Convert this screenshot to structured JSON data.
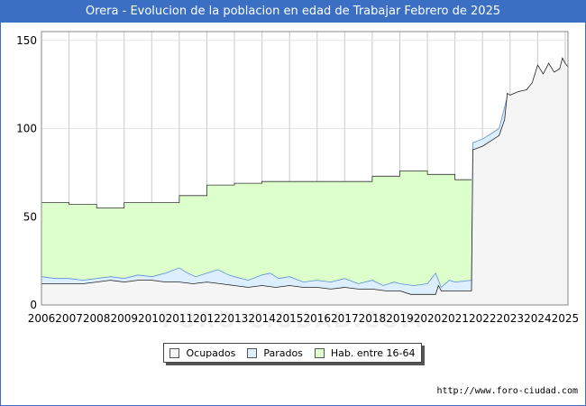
{
  "header": {
    "title": "Orera - Evolucion de la poblacion en edad de Trabajar Febrero de 2025"
  },
  "watermark": "FORO-CIUDAD.COM",
  "footer": {
    "url": "http://www.foro-ciudad.com"
  },
  "colors": {
    "header_bg": "#3a6fc4",
    "ocupados_fill": "#f5f5f5",
    "ocupados_line": "#222222",
    "parados_fill": "#ddeeff",
    "parados_line": "#5b8fd6",
    "hab_fill": "#ddffcc",
    "hab_line": "#333333",
    "grid": "#c8c8c8"
  },
  "chart_data": {
    "type": "area",
    "title": "Orera - Evolucion de la poblacion en edad de Trabajar Febrero de 2025",
    "xlim": [
      2006,
      2025.1
    ],
    "ylim": [
      0,
      155
    ],
    "x_ticks": [
      2006,
      2007,
      2008,
      2009,
      2010,
      2011,
      2012,
      2013,
      2014,
      2015,
      2016,
      2017,
      2018,
      2019,
      2020,
      2021,
      2022,
      2023,
      2024,
      2025
    ],
    "y_ticks": [
      0,
      50,
      100,
      150
    ],
    "grid": "vertical-and-horizontal",
    "legend": {
      "position": "bottom-center",
      "entries": [
        "Ocupados",
        "Parados",
        "Hab. entre 16-64"
      ]
    },
    "series": [
      {
        "name": "Hab. entre 16-64",
        "style": "step",
        "points": [
          [
            2006,
            58
          ],
          [
            2007,
            57
          ],
          [
            2008,
            55
          ],
          [
            2009,
            58
          ],
          [
            2011,
            62
          ],
          [
            2012,
            68
          ],
          [
            2013,
            69
          ],
          [
            2014,
            70
          ],
          [
            2018,
            73
          ],
          [
            2019,
            76
          ],
          [
            2020,
            74
          ],
          [
            2021,
            71
          ],
          [
            2021.6,
            71
          ]
        ]
      },
      {
        "name": "Parados",
        "style": "line",
        "points": [
          [
            2006,
            16
          ],
          [
            2006.5,
            15
          ],
          [
            2007,
            15
          ],
          [
            2007.5,
            14
          ],
          [
            2008,
            15
          ],
          [
            2008.5,
            16
          ],
          [
            2009,
            15
          ],
          [
            2009.5,
            17
          ],
          [
            2010,
            16
          ],
          [
            2010.5,
            18
          ],
          [
            2011,
            21
          ],
          [
            2011.3,
            18
          ],
          [
            2011.6,
            16
          ],
          [
            2012,
            18
          ],
          [
            2012.4,
            20
          ],
          [
            2012.8,
            17
          ],
          [
            2013,
            16
          ],
          [
            2013.5,
            14
          ],
          [
            2014,
            17
          ],
          [
            2014.3,
            18
          ],
          [
            2014.6,
            15
          ],
          [
            2015,
            16
          ],
          [
            2015.5,
            13
          ],
          [
            2016,
            14
          ],
          [
            2016.5,
            13
          ],
          [
            2017,
            15
          ],
          [
            2017.5,
            12
          ],
          [
            2018,
            14
          ],
          [
            2018.4,
            11
          ],
          [
            2018.8,
            13
          ],
          [
            2019,
            12
          ],
          [
            2019.5,
            11
          ],
          [
            2020,
            12
          ],
          [
            2020.3,
            18
          ],
          [
            2020.5,
            10
          ],
          [
            2020.8,
            14
          ],
          [
            2021,
            13
          ],
          [
            2021.6,
            14
          ],
          [
            2021.65,
            92
          ],
          [
            2022,
            94
          ],
          [
            2022.3,
            97
          ],
          [
            2022.6,
            100
          ],
          [
            2022.9,
            118
          ]
        ]
      },
      {
        "name": "Ocupados",
        "style": "line",
        "points": [
          [
            2006,
            12
          ],
          [
            2007,
            12
          ],
          [
            2007.5,
            12
          ],
          [
            2008,
            13
          ],
          [
            2008.5,
            14
          ],
          [
            2009,
            13
          ],
          [
            2009.5,
            14
          ],
          [
            2010,
            14
          ],
          [
            2010.5,
            13
          ],
          [
            2011,
            13
          ],
          [
            2011.5,
            12
          ],
          [
            2012,
            13
          ],
          [
            2012.5,
            12
          ],
          [
            2013,
            11
          ],
          [
            2013.5,
            10
          ],
          [
            2014,
            11
          ],
          [
            2014.5,
            10
          ],
          [
            2015,
            11
          ],
          [
            2015.5,
            10
          ],
          [
            2016,
            10
          ],
          [
            2016.5,
            9
          ],
          [
            2017,
            10
          ],
          [
            2017.5,
            9
          ],
          [
            2018,
            9
          ],
          [
            2018.5,
            8
          ],
          [
            2019,
            8
          ],
          [
            2019.4,
            6
          ],
          [
            2020,
            6
          ],
          [
            2020.3,
            6
          ],
          [
            2020.4,
            11
          ],
          [
            2020.5,
            8
          ],
          [
            2021,
            8
          ],
          [
            2021.6,
            8
          ],
          [
            2021.65,
            88
          ],
          [
            2022,
            90
          ],
          [
            2022.3,
            93
          ],
          [
            2022.6,
            96
          ],
          [
            2022.8,
            105
          ],
          [
            2022.9,
            120
          ],
          [
            2023,
            119
          ],
          [
            2023.3,
            121
          ],
          [
            2023.6,
            122
          ],
          [
            2023.8,
            126
          ],
          [
            2024,
            136
          ],
          [
            2024.2,
            131
          ],
          [
            2024.4,
            137
          ],
          [
            2024.6,
            132
          ],
          [
            2024.8,
            134
          ],
          [
            2024.9,
            140
          ],
          [
            2025,
            137
          ],
          [
            2025.1,
            135
          ]
        ]
      }
    ]
  }
}
